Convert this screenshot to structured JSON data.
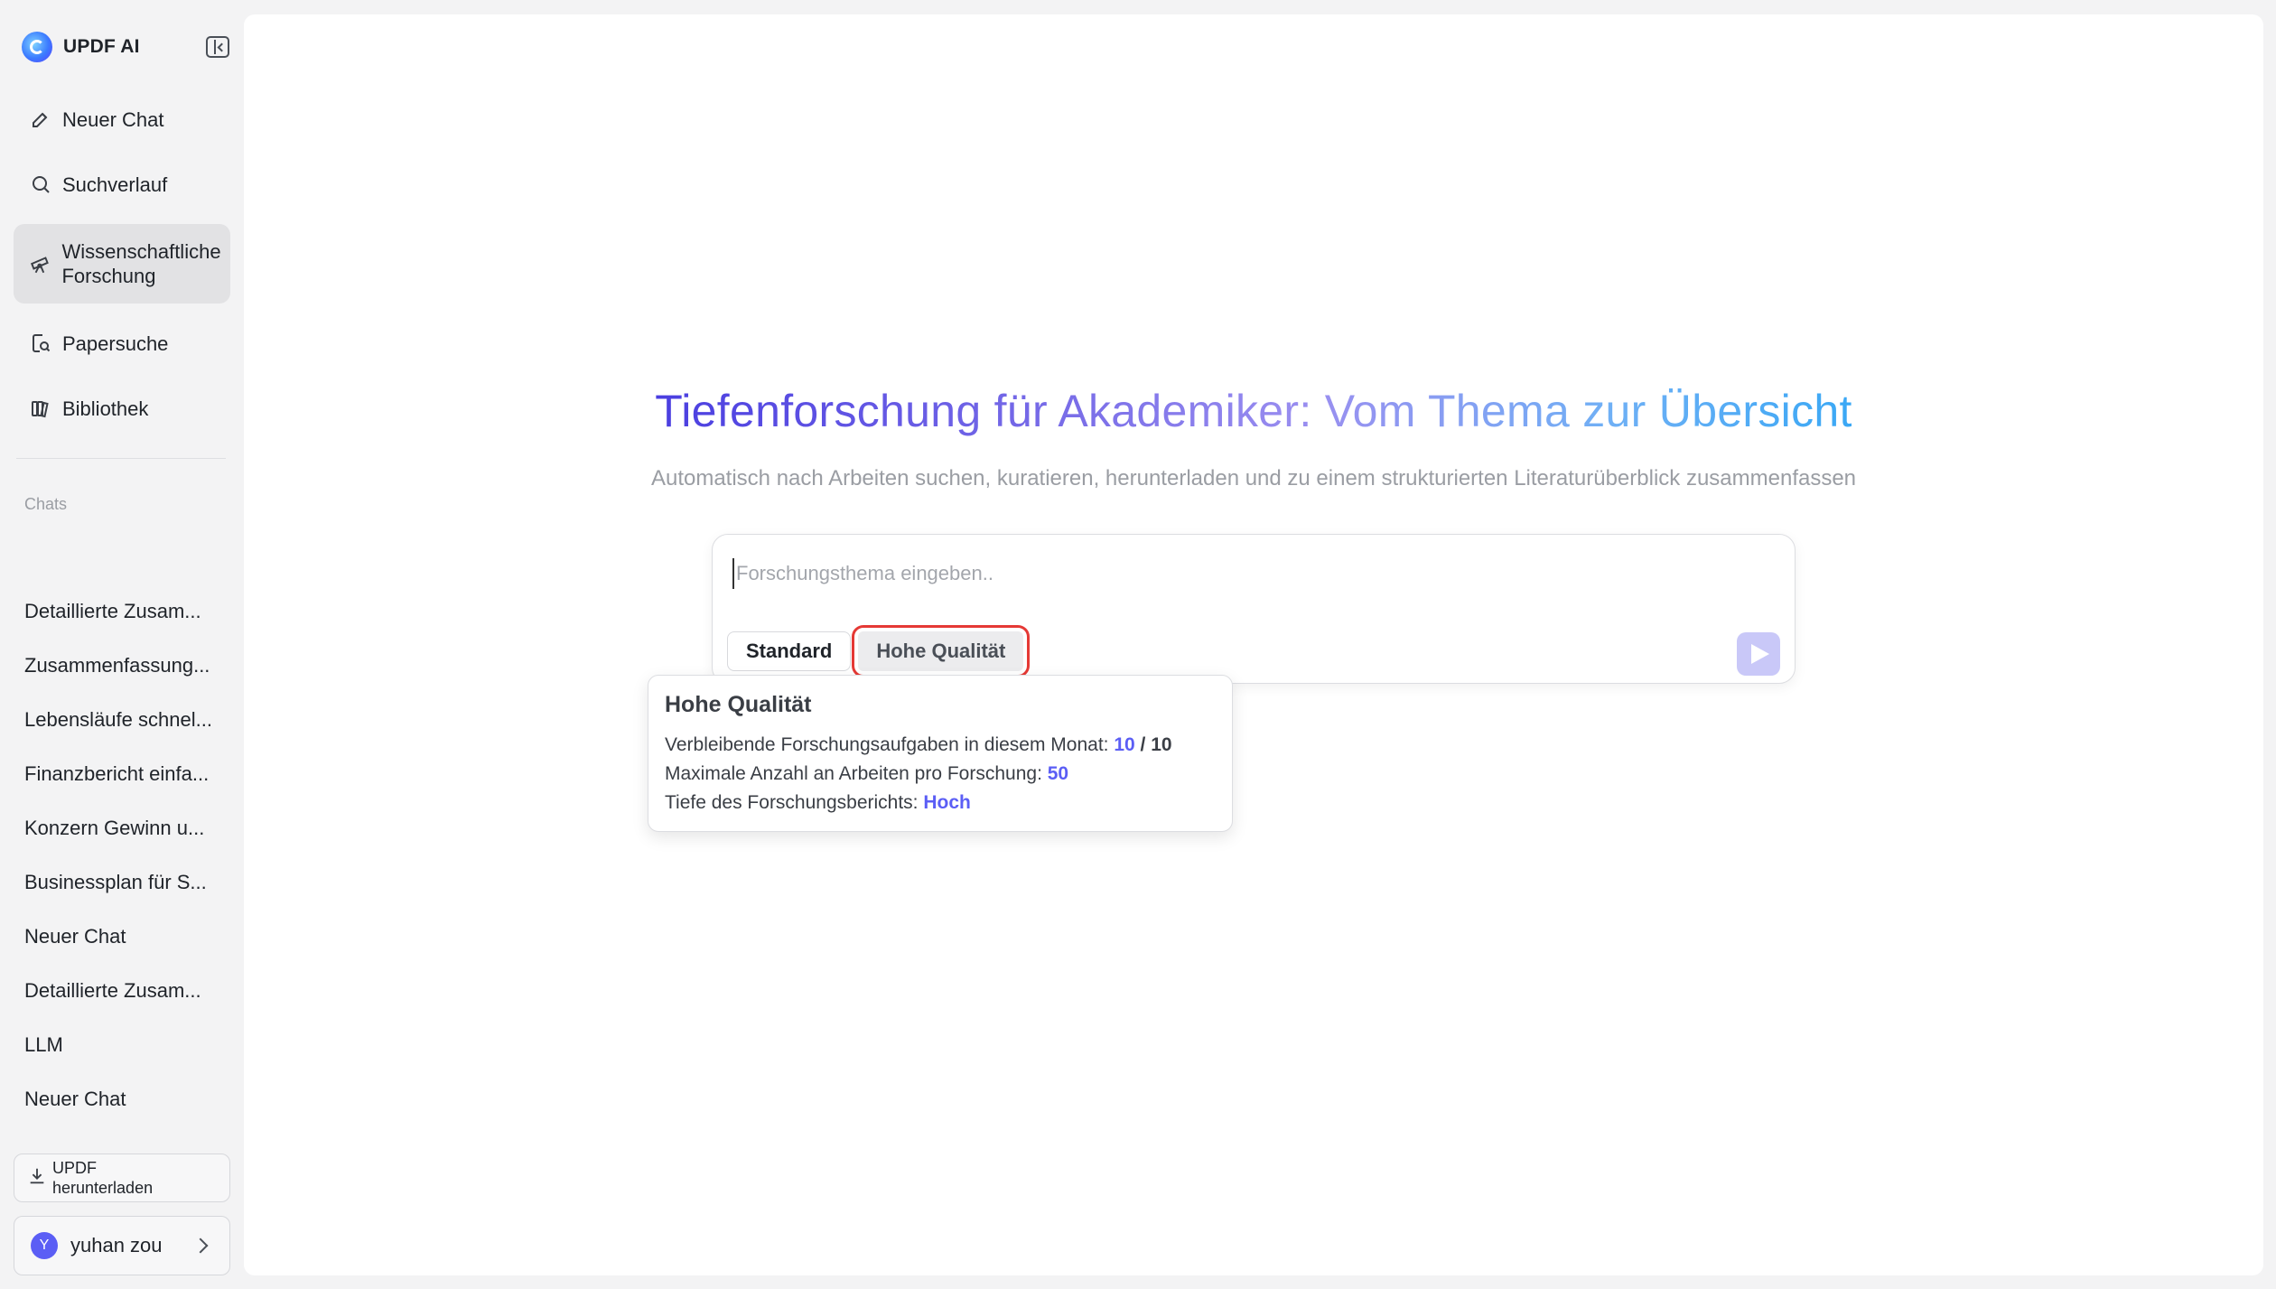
{
  "brand": {
    "name": "UPDF AI"
  },
  "nav": [
    {
      "label": "Neuer Chat",
      "icon": "edit-icon"
    },
    {
      "label": "Suchverlauf",
      "icon": "search-icon"
    },
    {
      "label": "Wissenschaftliche Forschung",
      "icon": "telescope-icon",
      "active": true
    },
    {
      "label": "Papersuche",
      "icon": "paper-search-icon"
    },
    {
      "label": "Bibliothek",
      "icon": "library-icon"
    }
  ],
  "chats": {
    "heading": "Chats",
    "items": [
      "Detaillierte Zusam...",
      "Zusammenfassung...",
      "Lebensläufe schnel...",
      "Finanzbericht einfa...",
      "Konzern Gewinn u...",
      "Businessplan für S...",
      "Neuer Chat",
      "Detaillierte Zusam...",
      "LLM",
      "Neuer Chat"
    ]
  },
  "download": {
    "label": "UPDF herunterladen"
  },
  "user": {
    "initial": "Y",
    "name": "yuhan zou"
  },
  "hero": {
    "title": "Tiefenforschung für Akademiker: Vom Thema zur Übersicht",
    "subtitle": "Automatisch nach Arbeiten suchen, kuratieren, herunterladen und zu einem strukturierten Literaturüberblick zusammenfassen"
  },
  "input": {
    "placeholder": "Forschungsthema eingeben.."
  },
  "modes": {
    "standard": "Standard",
    "high": "Hohe Qualität"
  },
  "tooltip": {
    "title": "Hohe Qualität",
    "remaining_label": "Verbleibende Forschungsaufgaben in diesem Monat: ",
    "remaining_value": "10",
    "remaining_sep": " / ",
    "remaining_total": "10",
    "max_label": "Maximale Anzahl an Arbeiten pro Forschung: ",
    "max_value": "50",
    "depth_label": "Tiefe des Forschungsberichts: ",
    "depth_value": "Hoch"
  },
  "colors": {
    "accent": "#5b5ef5",
    "highlight_border": "#e53935",
    "send_button": "#c9c8f8"
  }
}
